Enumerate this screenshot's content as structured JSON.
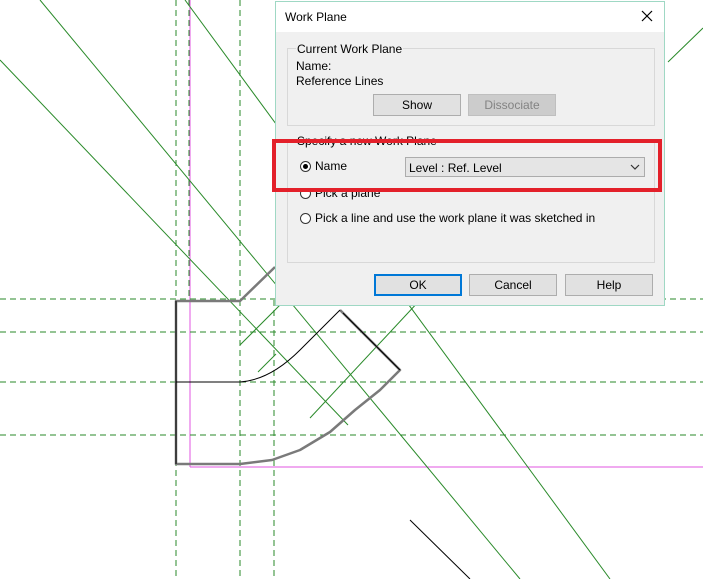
{
  "dialog": {
    "title": "Work Plane",
    "current_group_label": "Current Work Plane",
    "name_label": "Name:",
    "name_value": "Reference Lines",
    "show_label": "Show",
    "dissociate_label": "Dissociate",
    "specify_group_label": "Specify a new Work Plane",
    "option_name_label": "Name",
    "option_name_value": "Level : Ref. Level",
    "option_pick_plane_label": "Pick a plane",
    "option_pick_line_label": "Pick a line and use the work plane it was sketched in",
    "selected_option": "name",
    "ok_label": "OK",
    "cancel_label": "Cancel",
    "help_label": "Help"
  },
  "icons": {
    "close": "close-icon",
    "dropdown": "chevron-down-icon"
  },
  "colors": {
    "reference_line": "#2a8a2a",
    "sketch_line": "#7a7a7a",
    "boundary": "#e055e0",
    "highlight": "#e3202a",
    "dialog_border": "#9fd8c4",
    "default_button_border": "#0078d7"
  }
}
